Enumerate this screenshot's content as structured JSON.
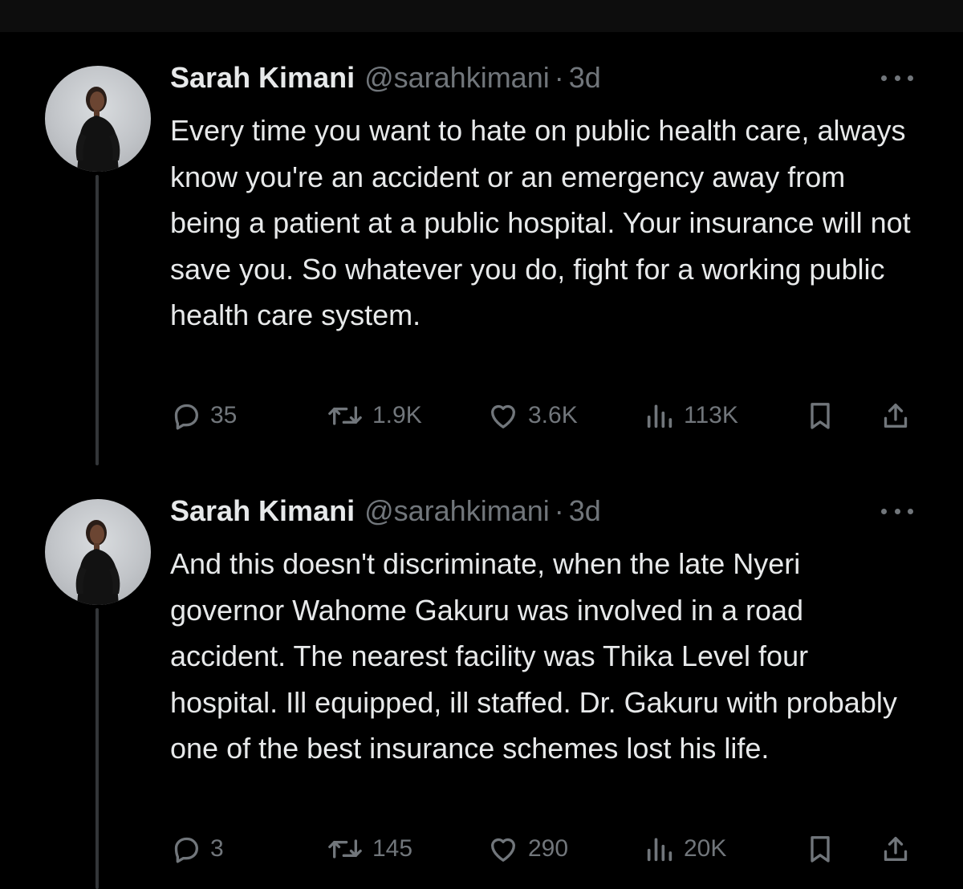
{
  "tweets": [
    {
      "author": {
        "name": "Sarah Kimani",
        "handle": "@sarahkimani",
        "separator": "·",
        "time": "3d"
      },
      "text": "Every time you want to hate on public health care, always know you're an accident or an emergency away from being a patient at a public hospital. Your insurance will not save you. So whatever you do, fight for a working public health care system.",
      "stats": {
        "replies": "35",
        "retweets": "1.9K",
        "likes": "3.6K",
        "views": "113K"
      }
    },
    {
      "author": {
        "name": "Sarah Kimani",
        "handle": "@sarahkimani",
        "separator": "·",
        "time": "3d"
      },
      "text": "And this doesn't discriminate, when the late Nyeri governor Wahome Gakuru was involved in a road accident. The nearest facility was Thika Level four hospital. Ill equipped, ill staffed. Dr. Gakuru with probably one of the best insurance schemes lost his life.",
      "stats": {
        "replies": "3",
        "retweets": "145",
        "likes": "290",
        "views": "20K"
      }
    }
  ],
  "icons": {
    "reply": "reply-icon",
    "retweet": "retweet-icon",
    "like": "heart-icon",
    "views": "views-chart-icon",
    "bookmark": "bookmark-icon",
    "share": "share-icon",
    "more": "more-horizontal-icon"
  },
  "colors": {
    "background": "#000000",
    "primary_text": "#e7e9ea",
    "secondary_text": "#71767b",
    "thread_line": "#333639"
  }
}
